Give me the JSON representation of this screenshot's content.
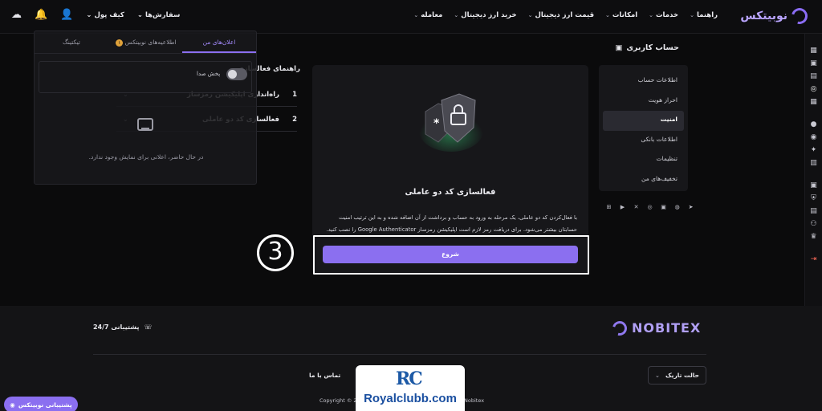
{
  "header": {
    "logo": "نوبیتکس",
    "nav": [
      {
        "label": "معامله",
        "chevron": true
      },
      {
        "label": "خرید ارز دیجیتال",
        "chevron": true
      },
      {
        "label": "قیمت ارز دیجیتال",
        "chevron": true
      },
      {
        "label": "امکانات",
        "chevron": true
      },
      {
        "label": "خدمات",
        "chevron": true
      },
      {
        "label": "راهنما",
        "chevron": true
      }
    ],
    "orders": "سفارش‌ها",
    "wallet": "کیف پول"
  },
  "account": {
    "title": "حساب کاربری",
    "menu": [
      "اطلاعات حساب",
      "احراز هویت",
      "امنیت",
      "اطلاعات بانکی",
      "تنظیمات",
      "تخفیف‌های من"
    ],
    "active_index": 2
  },
  "notifications": {
    "tabs": [
      "اعلان‌های من",
      "اطلاعیه‌های نوبیتکس",
      "تیکتینگ"
    ],
    "announce_badge": "۱",
    "sound_label": "پخش صدا",
    "empty": "در حال حاضر، اعلانی برای نمایش وجود ندارد."
  },
  "guide": {
    "title": "راهنمای فعالسازی",
    "items": [
      {
        "num": "1",
        "label": "راه‌اندازی اپلیکیشن رمزساز"
      },
      {
        "num": "2",
        "label": "فعالسازی کد دو عاملی"
      }
    ]
  },
  "card": {
    "title": "فعالسازی کد دو عاملی",
    "desc": "با فعال‌کردن کد دو عاملی، یک مرحله به ورود به حساب و برداشت از آن اضافه شده و به این ترتیب امنیت حسابتان بیشتر می‌شود. برای دریافت رمز لازم است اپلیکیشن رمزساز Google Authenticator را نصب کنید.",
    "button": "شروع",
    "step": "3"
  },
  "footer": {
    "logo": "NOBITEX",
    "support": "پشتیبانی 24/7",
    "theme": "حالت تاریک",
    "contact": "تماس با ما",
    "copyright": "Copyright © 2017",
    "copyright_end": "Nobitex",
    "chat": "پشتیبانی نوبیتکس"
  },
  "watermark": {
    "mark": "RC",
    "text": "Royalclubb.com"
  },
  "colors": {
    "accent": "#8b6ff0",
    "background": "#0b0b0c",
    "card": "#17171a"
  }
}
